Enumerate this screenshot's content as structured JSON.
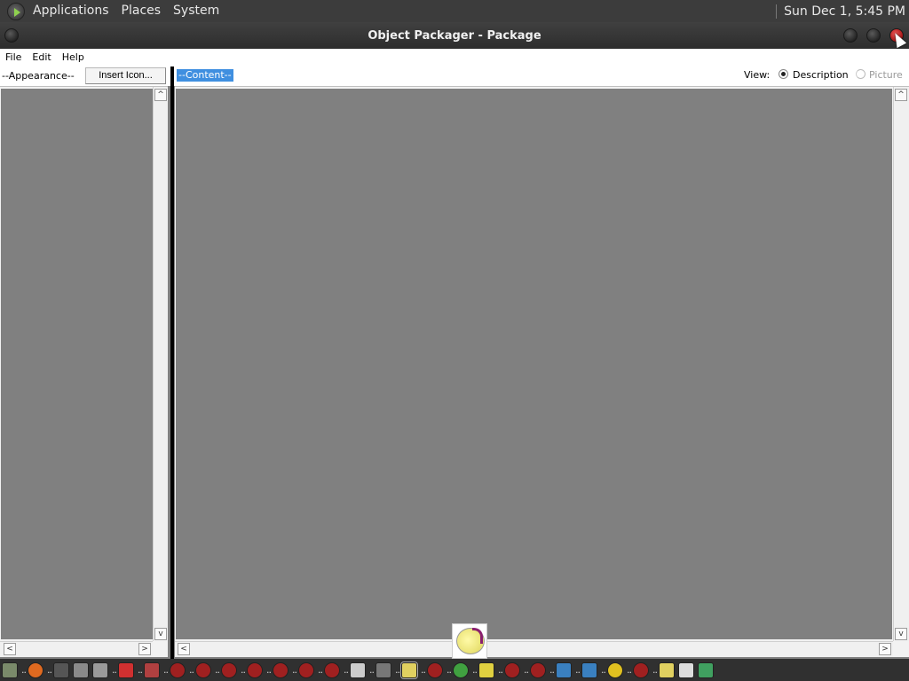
{
  "top_panel": {
    "menus": [
      "Applications",
      "Places",
      "System"
    ],
    "clock": "Sun Dec 1, 5:45 PM"
  },
  "window": {
    "title": "Object Packager - Package"
  },
  "menubar": {
    "file": "File",
    "edit": "Edit",
    "help": "Help"
  },
  "toolbar": {
    "appearance_label": "--Appearance--",
    "insert_icon_label": "Insert Icon...",
    "content_label": "--Content--",
    "view_label": "View:",
    "view_options": [
      {
        "label": "Description",
        "selected": true,
        "enabled": true
      },
      {
        "label": "Picture",
        "selected": false,
        "enabled": false
      }
    ]
  },
  "scroll_glyphs": {
    "up": "^",
    "down": "v",
    "left": "<",
    "right": ">"
  },
  "taskbar": {
    "items": [
      {
        "icon": "file-manager-icon",
        "color": "#7a8a6a"
      },
      {
        "icon": "firefox-icon",
        "color": "#e06a20"
      },
      {
        "icon": "terminal-icon",
        "color": "#555555"
      },
      {
        "icon": "folder-icon",
        "color": "#8a8a8a"
      },
      {
        "icon": "folder-icon",
        "color": "#9a9a9a"
      },
      {
        "icon": "package-icon",
        "color": "#d03030"
      },
      {
        "icon": "paint-icon",
        "color": "#b04040"
      },
      {
        "icon": "wine-icon",
        "color": "#a02020"
      },
      {
        "icon": "wine-icon",
        "color": "#a02020"
      },
      {
        "icon": "wine-icon",
        "color": "#a02020"
      },
      {
        "icon": "wine-icon",
        "color": "#a02020"
      },
      {
        "icon": "wine-icon",
        "color": "#a02020"
      },
      {
        "icon": "wine-icon",
        "color": "#a02020"
      },
      {
        "icon": "wine-icon",
        "color": "#a02020"
      },
      {
        "icon": "clapper-icon",
        "color": "#cccccc"
      },
      {
        "icon": "settings-icon",
        "color": "#777777"
      },
      {
        "icon": "notepad-icon",
        "color": "#e0d060"
      },
      {
        "icon": "wine-icon",
        "color": "#a02020"
      },
      {
        "icon": "globe-icon",
        "color": "#40a040"
      },
      {
        "icon": "speaker-icon",
        "color": "#e0d040"
      },
      {
        "icon": "wine-icon",
        "color": "#a02020"
      },
      {
        "icon": "wine-icon",
        "color": "#a02020"
      },
      {
        "icon": "app-a-icon",
        "color": "#3a80c0"
      },
      {
        "icon": "app-a-icon",
        "color": "#3a80c0"
      },
      {
        "icon": "pacman-icon",
        "color": "#e0c020"
      },
      {
        "icon": "wine-icon",
        "color": "#a02020"
      },
      {
        "icon": "notes-icon",
        "color": "#e0d060"
      },
      {
        "icon": "window-icon",
        "color": "#dddddd"
      },
      {
        "icon": "monitor-icon",
        "color": "#40a060"
      }
    ]
  },
  "colors": {
    "panel_bg": "#3c3c3c",
    "workspace_gray": "#808080",
    "selection_blue": "#3f8fe0",
    "close_red": "#cc2020"
  }
}
